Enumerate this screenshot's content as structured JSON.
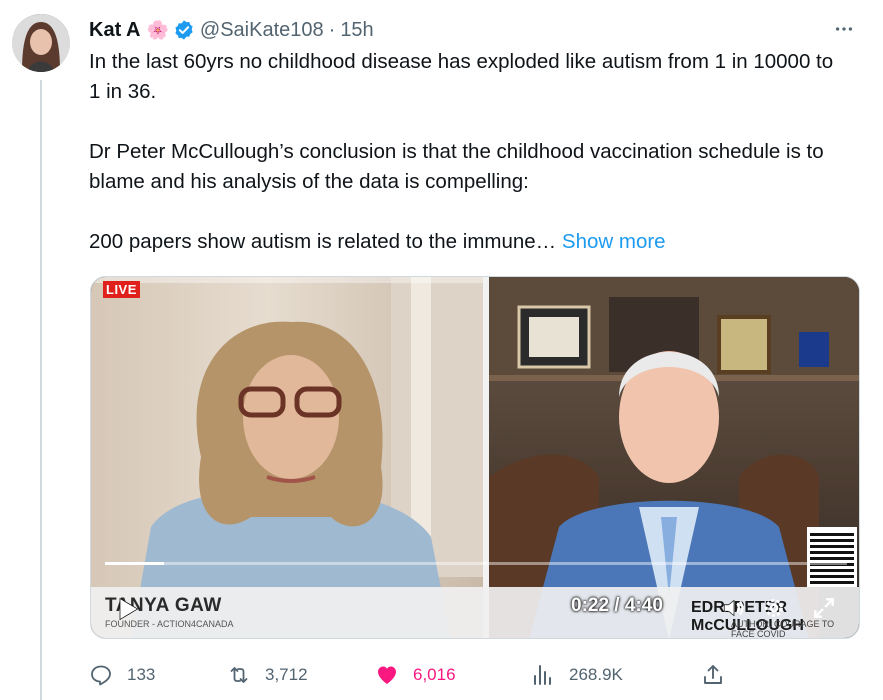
{
  "author": {
    "display_name": "Kat A",
    "emoji": "🌸",
    "handle": "@SaiKate108",
    "separator": "·",
    "time": "15h"
  },
  "tweet": {
    "paragraph_1": "In the last 60yrs no childhood disease has exploded like autism from 1 in 10000 to 1 in 36.",
    "paragraph_2": "Dr Peter McCullough’s conclusion is that the childhood vaccination schedule is to blame and his analysis of the data is compelling:",
    "paragraph_3": "200 papers show autism is related to the immune…",
    "show_more": "Show more"
  },
  "video": {
    "live_badge": "LIVE",
    "left_name": "TANYA GAW",
    "left_subtitle": "FOUNDER - ACTION4CANADA",
    "right_name": "EDR. PETER McCULLOUGH",
    "right_subtitle": "AUTHOR, COURAGE TO FACE COVID",
    "timecode": "0:22 / 4:40",
    "progress": 0.08
  },
  "actions": {
    "replies": "133",
    "reposts": "3,712",
    "likes": "6,016",
    "views": "268.9K"
  },
  "colors": {
    "accent": "#1d9bf0",
    "like": "#f91880",
    "muted": "#536471"
  }
}
